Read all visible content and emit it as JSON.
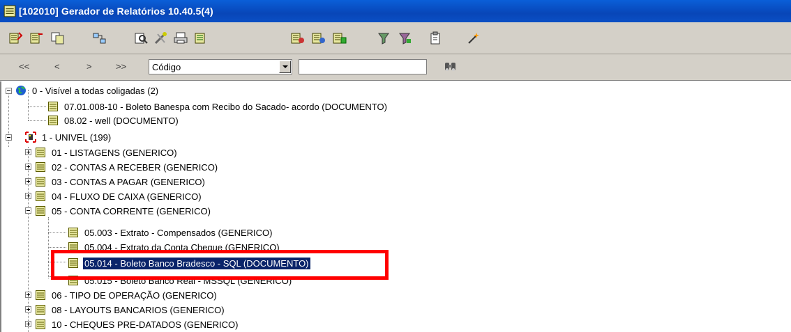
{
  "window": {
    "title": "[102010] Gerador de Relatórios 10.40.5(4)"
  },
  "toolbar": {
    "icons": [
      "new-report-icon",
      "edit-report-icon",
      "copy-report-icon",
      "import-icon",
      "preview-icon",
      "tools-icon",
      "print-icon",
      "properties-icon",
      "generate-icon",
      "generate-all-icon",
      "group-icon",
      "filter-icon",
      "filter-group-icon",
      "paste-icon",
      "wizard-icon"
    ]
  },
  "nav": {
    "first": "<<",
    "prev": "<",
    "next": ">",
    "last": ">>",
    "combo_value": "Código",
    "search_value": ""
  },
  "tree": {
    "nodes": [
      {
        "label": "0 - Visível a todas coligadas (2)"
      },
      {
        "label": "07.01.008-10 - Boleto Banespa com Recibo do Sacado- acordo (DOCUMENTO)"
      },
      {
        "label": "08.02 - well (DOCUMENTO)"
      },
      {
        "label": "1 - UNIVEL (199)"
      },
      {
        "label": "01 - LISTAGENS (GENERICO)"
      },
      {
        "label": "02 - CONTAS A RECEBER (GENERICO)"
      },
      {
        "label": "03 - CONTAS A PAGAR (GENERICO)"
      },
      {
        "label": "04 - FLUXO DE CAIXA (GENERICO)"
      },
      {
        "label": "05 - CONTA CORRENTE (GENERICO)"
      },
      {
        "label": "05.003 - Extrato - Compensados (GENERICO)"
      },
      {
        "label": "05.004 - Extrato da Conta Cheque (GENERICO)"
      },
      {
        "label": "05.014 - Boleto Banco Bradesco - SQL (DOCUMENTO)"
      },
      {
        "label": "05.015 - Boleto Banco Real - MSSQL (GENERICO)"
      },
      {
        "label": "06 - TIPO DE OPERAÇÃO (GENERICO)"
      },
      {
        "label": "08 - LAYOUTS BANCARIOS (GENERICO)"
      },
      {
        "label": "10 - CHEQUES PRE-DATADOS (GENERICO)"
      }
    ]
  },
  "colors": {
    "selection": "#0a246a",
    "highlight_box": "#ff0000",
    "titlebar": "#0846b8"
  }
}
